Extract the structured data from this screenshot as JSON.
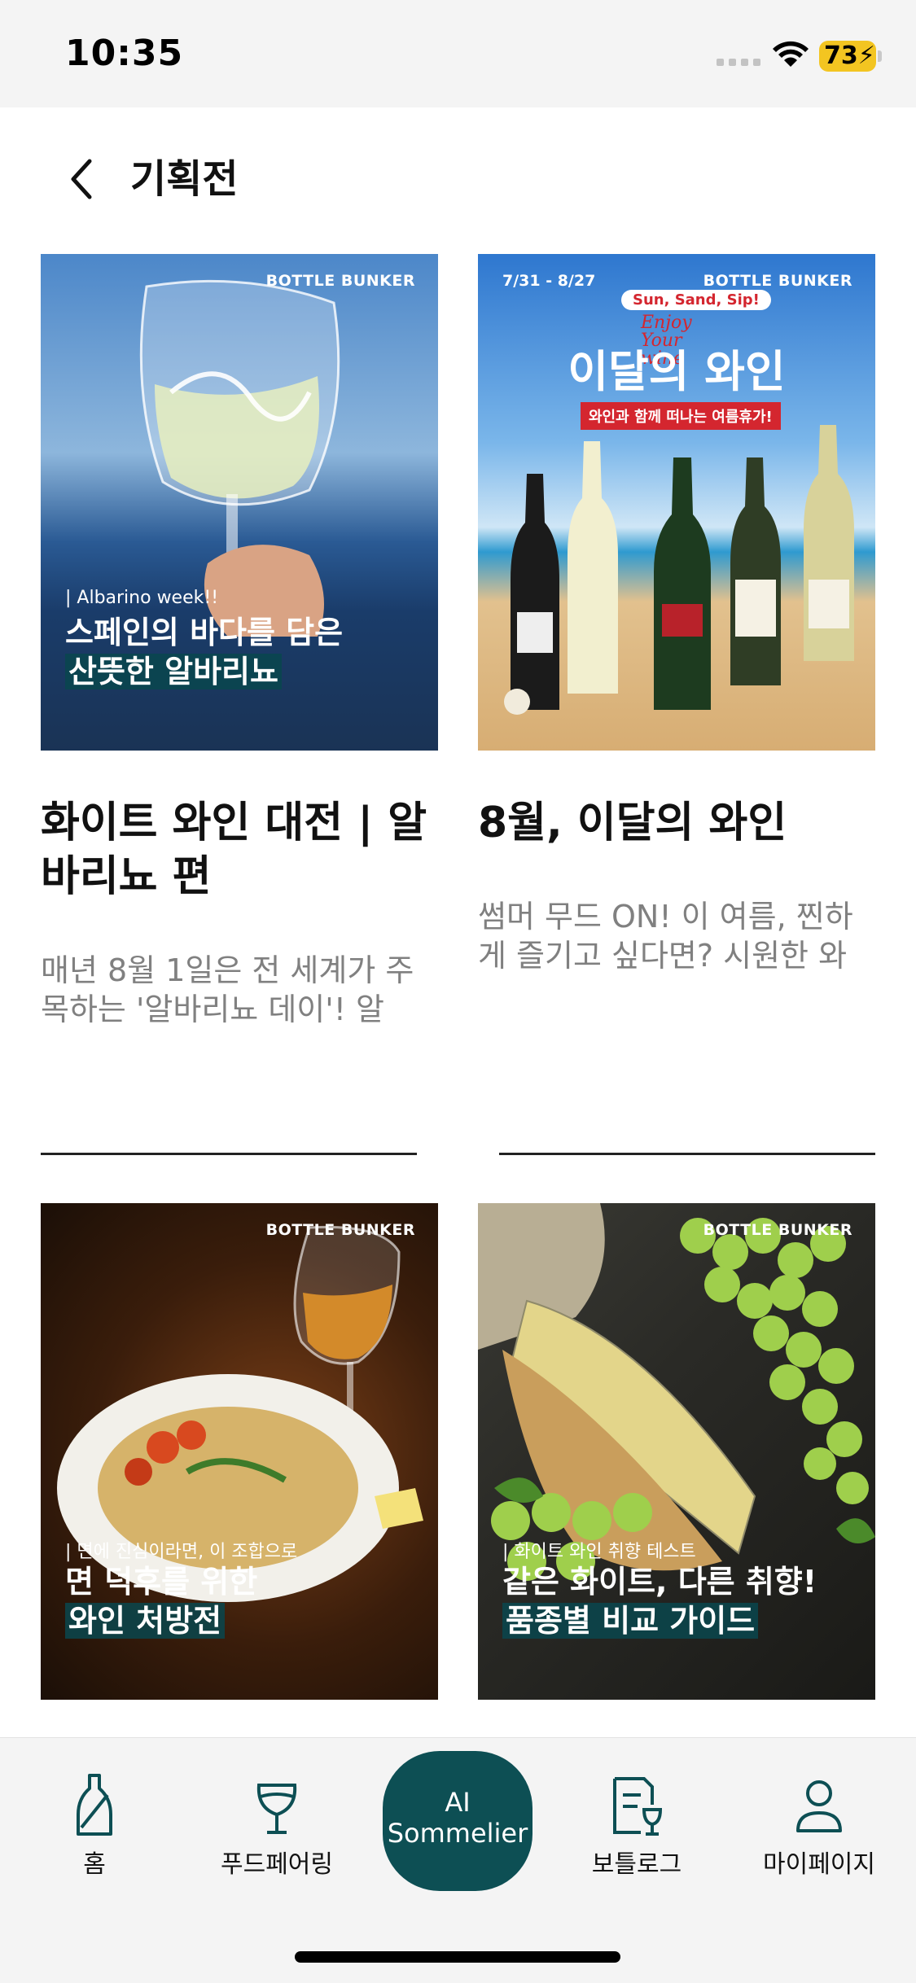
{
  "status_bar": {
    "time": "10:35",
    "battery": "73"
  },
  "header": {
    "title": "기획전"
  },
  "cards": [
    {
      "brand": "BOTTLE BUNKER",
      "tag": "| Albarino week!!",
      "headline_1": "스페인의 바다를 담은",
      "headline_2": "산뜻한 알바리뇨",
      "title": "화이트 와인 대전 | 알바리뇨 편",
      "description": "매년 8월 1일은 전 세계가 주목하는 '알바리뇨 데이'! 알바…"
    },
    {
      "brand": "BOTTLE BUNKER",
      "date": "7/31 - 8/27",
      "badge": "Sun, Sand, Sip!",
      "script": "Enjoy Your wine",
      "headline": "이달의 와인",
      "subline": "와인과 함께 떠나는 여름휴가!",
      "title": "8월, 이달의 와인",
      "description": "썸머 무드 ON! 이 여름, 찐하게 즐기고 싶다면? 시원한 와인…"
    },
    {
      "brand": "BOTTLE BUNKER",
      "tag": "| 면에 진심이라면, 이 조합으로",
      "headline_1": "면 덕후를 위한",
      "headline_2": "와인 처방전"
    },
    {
      "brand": "BOTTLE BUNKER",
      "tag": "| 화이트 와인 취향 테스트",
      "headline_1": "같은 화이트, 다른 취향!",
      "headline_2": "품종별 비교 가이드"
    }
  ],
  "tab_bar": {
    "home": "홈",
    "food_pairing": "푸드페어링",
    "ai_line1": "AI",
    "ai_line2": "Sommelier",
    "bottle_log": "보틀로그",
    "my_page": "마이페이지"
  },
  "colors": {
    "accent": "#0d4f54",
    "battery": "#f3c521"
  }
}
